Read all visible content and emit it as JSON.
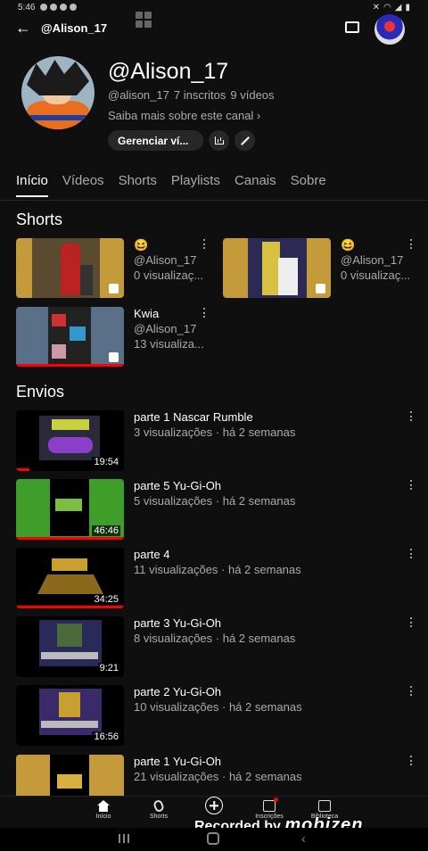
{
  "status_bar": {
    "time": "5:46"
  },
  "header": {
    "back_icon": "arrow-left-icon",
    "handle": "@Alison_17",
    "cast_icon": "cast-icon"
  },
  "channel": {
    "name": "@Alison_17",
    "handle": "@alison_17",
    "subscribers": "7 inscritos",
    "videos": "9 vídeos",
    "about": "Saiba mais sobre este canal ›",
    "manage_button": "Gerenciar ví...",
    "stats_icon": "analytics-icon",
    "edit_icon": "pencil-icon"
  },
  "tabs": [
    "Início",
    "Vídeos",
    "Shorts",
    "Playlists",
    "Canais",
    "Sobre"
  ],
  "shorts_section": {
    "title": "Shorts",
    "items": [
      {
        "title": "😆",
        "channel": "@Alison_17",
        "views": "0 visualizaç..."
      },
      {
        "title": "😆",
        "channel": "@Alison_17",
        "views": "0 visualizaç..."
      },
      {
        "title": "Kwia",
        "channel": "@Alison_17",
        "views": "13 visualiza..."
      }
    ]
  },
  "uploads_section": {
    "title": "Envios",
    "items": [
      {
        "title": "parte 1 Nascar Rumble",
        "meta": "3 visualizações · há 2 semanas",
        "duration": "19:54",
        "progress": 0.12
      },
      {
        "title": "parte 5 Yu-Gi-Oh",
        "meta": "5 visualizações · há 2 semanas",
        "duration": "46:46",
        "progress": 1.0
      },
      {
        "title": "parte 4",
        "meta": "11 visualizações · há 2 semanas",
        "duration": "34:25",
        "progress": 1.0
      },
      {
        "title": "parte 3 Yu-Gi-Oh",
        "meta": "8 visualizações · há 2 semanas",
        "duration": "9:21",
        "progress": 0.0
      },
      {
        "title": "parte 2 Yu-Gi-Oh",
        "meta": "10 visualizações · há 2 semanas",
        "duration": "16:56",
        "progress": 0.0
      },
      {
        "title": "parte 1 Yu-Gi-Oh",
        "meta": "21 visualizações · há 2 semanas",
        "duration": "",
        "progress": 0.0
      }
    ]
  },
  "bottom_nav": {
    "home": "Início",
    "shorts": "Shorts",
    "subscriptions": "Inscrições",
    "library": "Biblioteca"
  },
  "watermark": {
    "prefix": "Recorded by",
    "brand": "mobizen"
  },
  "colors": {
    "background": "#0f0f0f",
    "accent": "#ff0000",
    "secondary_text": "#aaaaaa"
  }
}
